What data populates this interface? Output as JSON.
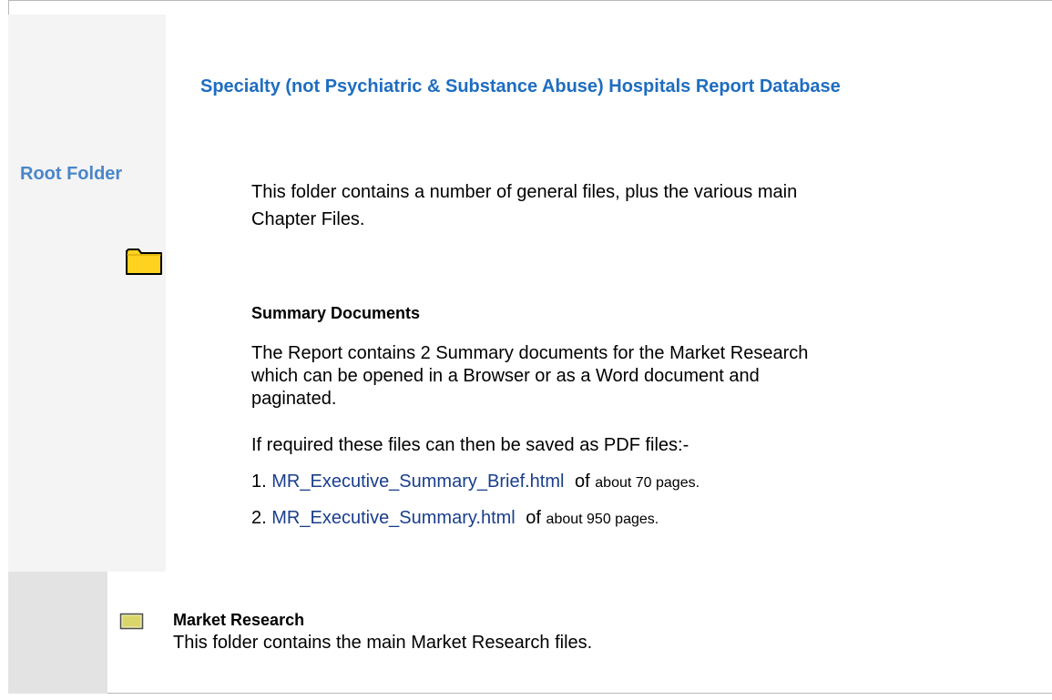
{
  "left_column": {
    "label": "Root Folder",
    "folder_icon": "folder-icon"
  },
  "main": {
    "title": "Specialty (not Psychiatric & Substance Abuse) Hospitals Report Database",
    "intro": "This folder contains a number of general files, plus the various main Chapter Files.",
    "summary": {
      "heading": "Summary Documents",
      "description": "The Report contains 2 Summary documents for the Market Research which can be opened in a Browser or as a Word document and paginated.",
      "pdf_note": "If required these files can then be saved as PDF files:-",
      "documents": [
        {
          "index": "1.",
          "link": "MR_Executive_Summary_Brief.html",
          "of": "of",
          "size": "about 70 pages."
        },
        {
          "index": "2.",
          "link": "MR_Executive_Summary.html",
          "of": "of",
          "size": "about 950 pages."
        }
      ]
    }
  },
  "market_research": {
    "icon": "folder-small-icon",
    "title": "Market Research",
    "description": "This folder contains the main Market Research files."
  },
  "colors": {
    "title_blue": "#1e6dc0",
    "root_label_blue": "#4a86c8",
    "link_blue": "#1a3e8c",
    "folder_yellow": "#ffd21f",
    "left_panel": "#f4f4f4",
    "lower_band": "#e3e3e3"
  }
}
